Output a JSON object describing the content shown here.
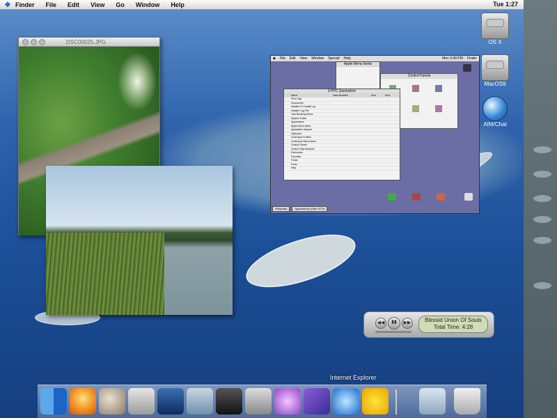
{
  "menubar": {
    "apple": "",
    "items": [
      "Finder",
      "File",
      "Edit",
      "View",
      "Go",
      "Window",
      "Help"
    ],
    "clock": "Tue 1:27"
  },
  "photo_window": {
    "title": "DSC00025.JPG"
  },
  "desktop_icons": [
    {
      "label": "OS X"
    },
    {
      "label": "MacOS9"
    },
    {
      "label": "AIM/Chat"
    }
  ],
  "os9": {
    "menubar": [
      "File",
      "Edit",
      "View",
      "Window",
      "Special",
      "Help"
    ],
    "clock": "Mon 3:40 PM",
    "finder_label": "Finder",
    "about_panel_title": "Apple Menu Items",
    "control_panel_title": "Control Panels",
    "list_window": {
      "title": "9 PPC Quicksilver",
      "header": [
        "Name",
        "Date Modified",
        "Size",
        "Kind"
      ],
      "rows": [
        "Print Help",
        "Documents",
        "Installer 9.0 Install Log",
        "Installer Log File",
        "Late Breaking News",
        "System Folder",
        "Appearance",
        "Apple Menu Items",
        "Application Support",
        "Clipboard",
        "ColorSync Profiles",
        "Contextual Menu Items",
        "Control Panels",
        "Control Strip Modules",
        "Extensions",
        "Favorites",
        "Finder",
        "Fonts",
        "Help"
      ]
    },
    "tabs": [
      "Wikipedia",
      "Applications (Mac OS 9)"
    ]
  },
  "player": {
    "track": "Blessid Union Of Souls",
    "time": "Total Time: 4:28",
    "play": "▶▮▮",
    "prev": "◀◀",
    "next": "▶▶"
  },
  "dock": {
    "hover_label": "Internet Explorer",
    "items": [
      "Finder",
      "Sherlock Sun",
      "Sherlock",
      "Image Capture",
      "QuickTime",
      "iPhoto",
      "iMovie",
      "Camera",
      "iTunes",
      "Mail",
      "Internet Explorer",
      "iChat",
      "Documents",
      "Trash"
    ]
  },
  "colors": {
    "desktop": "#1b4f97",
    "menu_bar": "#e8e8e8",
    "sidebar": "#5b6a70"
  }
}
